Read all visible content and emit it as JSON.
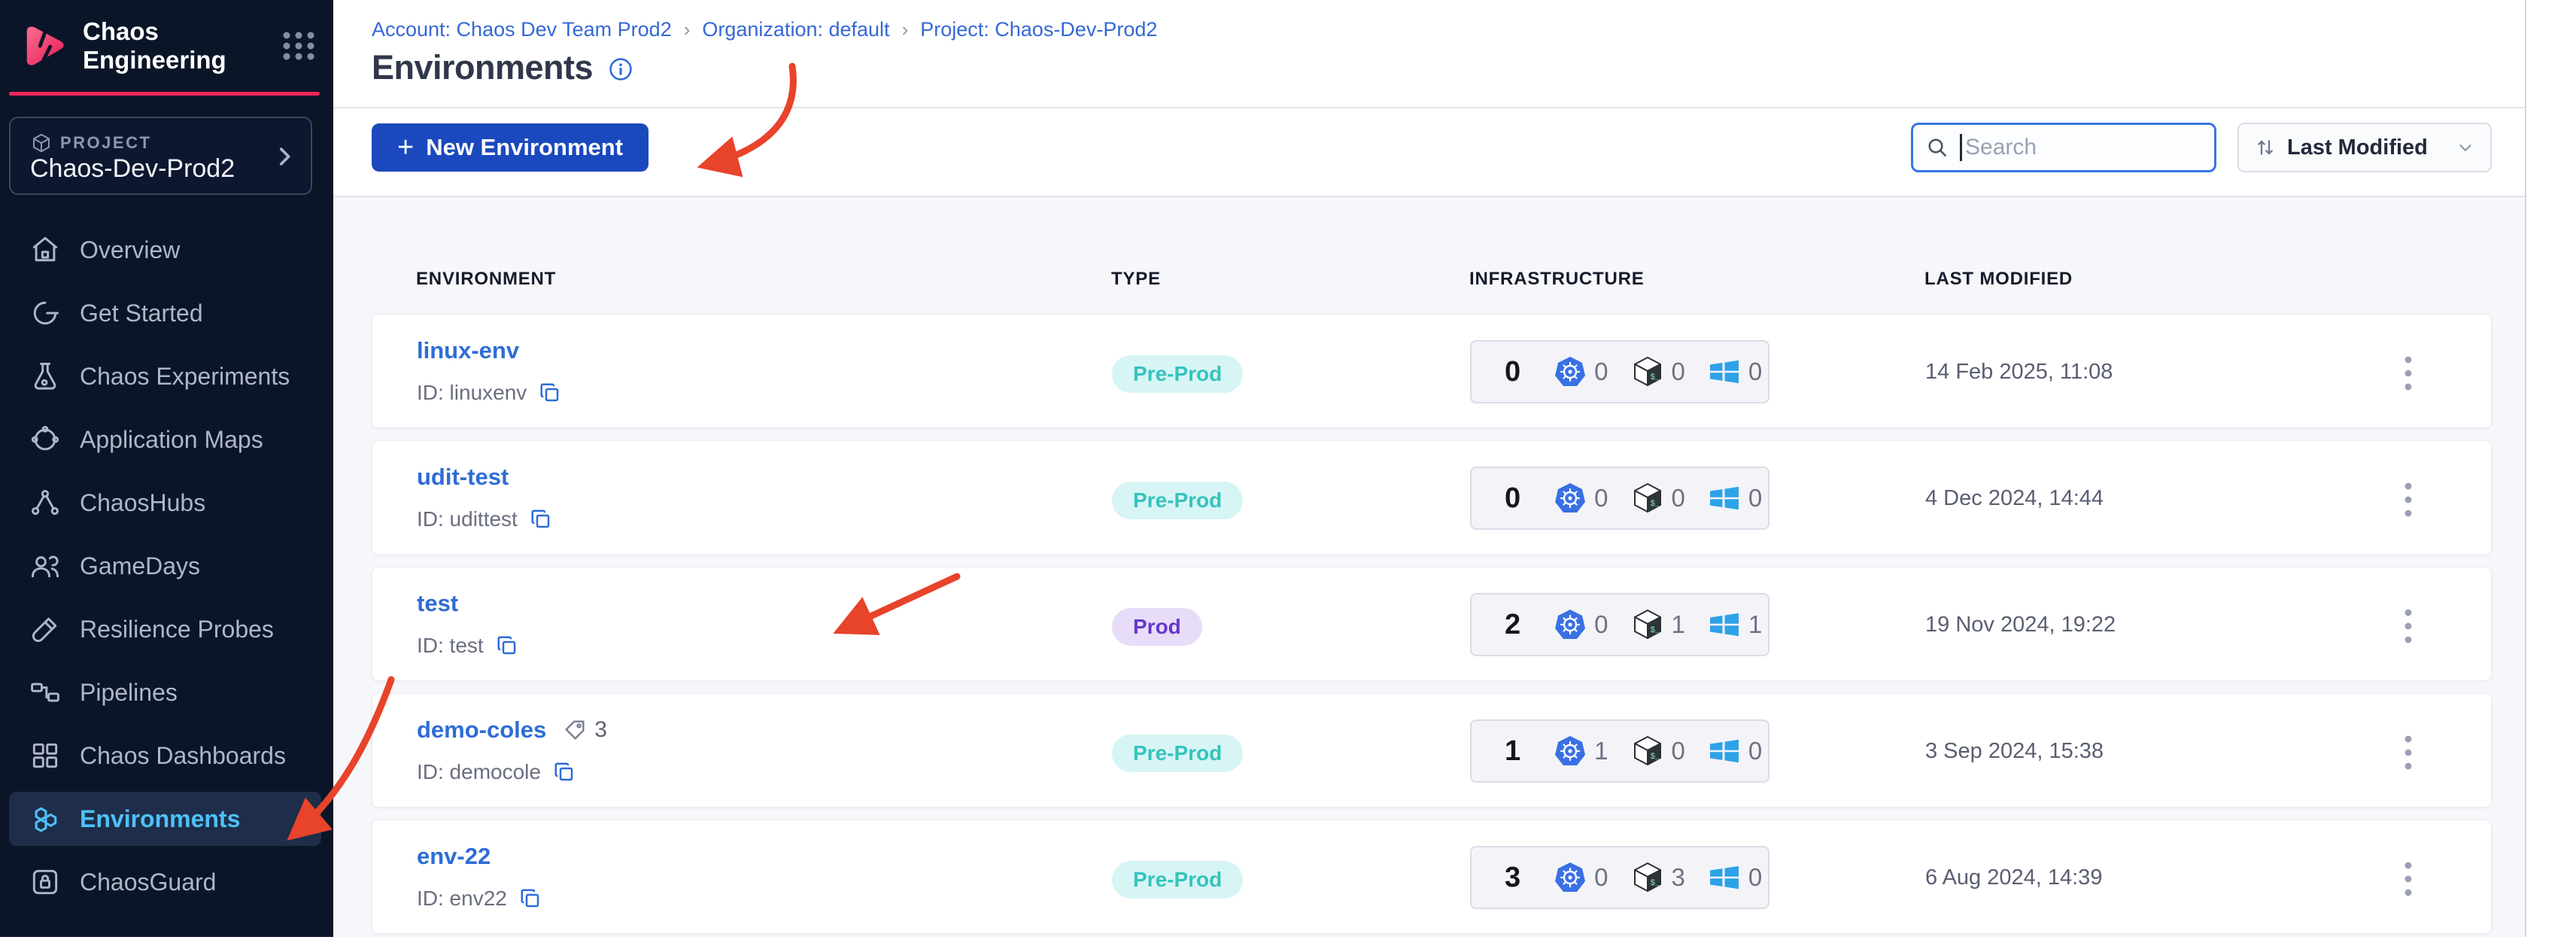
{
  "sidebar": {
    "brand": "Chaos Engineering",
    "project_label": "PROJECT",
    "project_name": "Chaos-Dev-Prod2",
    "items": [
      {
        "label": "Overview",
        "icon": "home-icon"
      },
      {
        "label": "Get Started",
        "icon": "get-started-icon"
      },
      {
        "label": "Chaos Experiments",
        "icon": "flask-icon"
      },
      {
        "label": "Application Maps",
        "icon": "application-maps-icon"
      },
      {
        "label": "ChaosHubs",
        "icon": "hub-icon"
      },
      {
        "label": "GameDays",
        "icon": "people-icon"
      },
      {
        "label": "Resilience Probes",
        "icon": "probe-icon"
      },
      {
        "label": "Pipelines",
        "icon": "pipeline-icon"
      },
      {
        "label": "Chaos Dashboards",
        "icon": "dashboard-icon"
      },
      {
        "label": "Environments",
        "icon": "hexagons-icon",
        "active": true
      },
      {
        "label": "ChaosGuard",
        "icon": "lock-icon"
      }
    ]
  },
  "header": {
    "breadcrumb": [
      {
        "label": "Account: Chaos Dev Team Prod2"
      },
      {
        "label": "Organization: default"
      },
      {
        "label": "Project: Chaos-Dev-Prod2"
      }
    ],
    "title": "Environments"
  },
  "toolbar": {
    "new_button_plus": "+",
    "new_button_label": "New Environment",
    "search_placeholder": "Search",
    "sort_label": "Last Modified"
  },
  "table": {
    "columns": [
      "ENVIRONMENT",
      "TYPE",
      "INFRASTRUCTURE",
      "LAST MODIFIED"
    ],
    "rows": [
      {
        "name": "linux-env",
        "id_label": "ID: linuxenv",
        "type": "Pre-Prod",
        "type_variant": "preprod",
        "total": "0",
        "k8s": "0",
        "linux": "0",
        "windows": "0",
        "modified": "14 Feb 2025, 11:08"
      },
      {
        "name": "udit-test",
        "id_label": "ID: udittest",
        "type": "Pre-Prod",
        "type_variant": "preprod",
        "total": "0",
        "k8s": "0",
        "linux": "0",
        "windows": "0",
        "modified": "4 Dec 2024, 14:44"
      },
      {
        "name": "test",
        "id_label": "ID: test",
        "type": "Prod",
        "type_variant": "prod",
        "total": "2",
        "k8s": "0",
        "linux": "1",
        "windows": "1",
        "modified": "19 Nov 2024, 19:22"
      },
      {
        "name": "demo-coles",
        "id_label": "ID: democole",
        "tag_count": "3",
        "type": "Pre-Prod",
        "type_variant": "preprod",
        "total": "1",
        "k8s": "1",
        "linux": "0",
        "windows": "0",
        "modified": "3 Sep 2024, 15:38"
      },
      {
        "name": "env-22",
        "id_label": "ID: env22",
        "type": "Pre-Prod",
        "type_variant": "preprod",
        "total": "3",
        "k8s": "0",
        "linux": "3",
        "windows": "0",
        "modified": "6 Aug 2024, 14:39"
      }
    ]
  },
  "colors": {
    "brand_pink": "#f3255e",
    "accent_button_blue": "#1b49bd",
    "link_blue": "#2e6cd6",
    "active_nav_blue": "#4fc0f8",
    "badge_preprod_text": "#35c3bd",
    "badge_prod_text": "#6836c9",
    "kubernetes_blue": "#3970e4",
    "windows_blue": "#2ea2e8",
    "annotation_red": "#e8432b"
  }
}
